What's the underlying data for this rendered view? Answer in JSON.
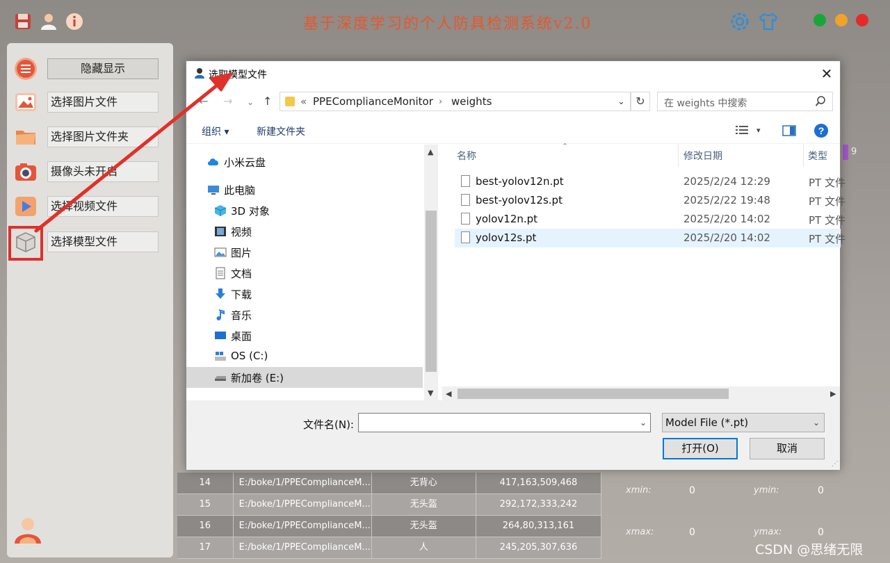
{
  "app": {
    "title": "基于深度学习的个人防具检测系统v2.0",
    "colors": {
      "title": "#e4582c",
      "close": "#e32b2b",
      "minimize": "#f2a22a",
      "maximize": "#1aa539",
      "highlight": "#e0302a"
    }
  },
  "sidebar": {
    "items": [
      {
        "label": "隐藏显示",
        "icon": "list-menu-icon"
      },
      {
        "label": "选择图片文件",
        "icon": "image-file-icon"
      },
      {
        "label": "选择图片文件夹",
        "icon": "folder-icon"
      },
      {
        "label": "摄像头未开启",
        "icon": "camera-icon"
      },
      {
        "label": "选择视频文件",
        "icon": "video-play-icon"
      },
      {
        "label": "选择模型文件",
        "icon": "model-box-icon"
      }
    ]
  },
  "background_table": {
    "rows": [
      {
        "id": "14",
        "path": "E:/boke/1/PPEComplianceM...",
        "cls": "无背心",
        "box": "417,163,509,468"
      },
      {
        "id": "15",
        "path": "E:/boke/1/PPEComplianceM...",
        "cls": "无头盔",
        "box": "292,172,333,242"
      },
      {
        "id": "16",
        "path": "E:/boke/1/PPEComplianceM...",
        "cls": "无头盔",
        "box": "264,80,313,161"
      },
      {
        "id": "17",
        "path": "E:/boke/1/PPEComplianceM...",
        "cls": "人",
        "box": "245,205,307,636"
      }
    ]
  },
  "coords": {
    "xmin_label": "xmin:",
    "xmin": "0",
    "ymin_label": "ymin:",
    "ymin": "0",
    "xmax_label": "xmax:",
    "xmax": "0",
    "ymax_label": "ymax:",
    "ymax": "0"
  },
  "side_stub": "9",
  "watermark": "CSDN @思绪无限",
  "dialog": {
    "title": "选取模型文件",
    "address": {
      "prefix": "«",
      "crumbs": [
        "PPEComplianceMonitor",
        "weights"
      ]
    },
    "search_placeholder": "在 weights 中搜索",
    "toolbar": {
      "organize": "组织 ▾",
      "new_folder": "新建文件夹"
    },
    "nav": [
      {
        "label": "小米云盘",
        "icon": "cloud-icon"
      },
      {
        "label": "此电脑",
        "icon": "computer-icon"
      },
      {
        "label": "3D 对象",
        "icon": "cube-3d-icon"
      },
      {
        "label": "视频",
        "icon": "film-icon"
      },
      {
        "label": "图片",
        "icon": "picture-icon"
      },
      {
        "label": "文档",
        "icon": "document-icon"
      },
      {
        "label": "下载",
        "icon": "download-icon"
      },
      {
        "label": "音乐",
        "icon": "music-icon"
      },
      {
        "label": "桌面",
        "icon": "desktop-icon"
      },
      {
        "label": "OS (C:)",
        "icon": "drive-c-icon"
      },
      {
        "label": "新加卷 (E:)",
        "icon": "drive-e-icon"
      }
    ],
    "columns": {
      "name": "名称",
      "date": "修改日期",
      "type": "类型"
    },
    "files": [
      {
        "name": "best-yolov12n.pt",
        "date": "2025/2/24 12:29",
        "type": "PT 文件"
      },
      {
        "name": "best-yolov12s.pt",
        "date": "2025/2/22 19:48",
        "type": "PT 文件"
      },
      {
        "name": "yolov12n.pt",
        "date": "2025/2/20 14:02",
        "type": "PT 文件"
      },
      {
        "name": "yolov12s.pt",
        "date": "2025/2/20 14:02",
        "type": "PT 文件"
      }
    ],
    "selected_file_index": 3,
    "filename_label": "文件名(N):",
    "filename_value": "",
    "filetype": "Model File (*.pt)",
    "open_button": "打开(O)",
    "cancel_button": "取消"
  }
}
